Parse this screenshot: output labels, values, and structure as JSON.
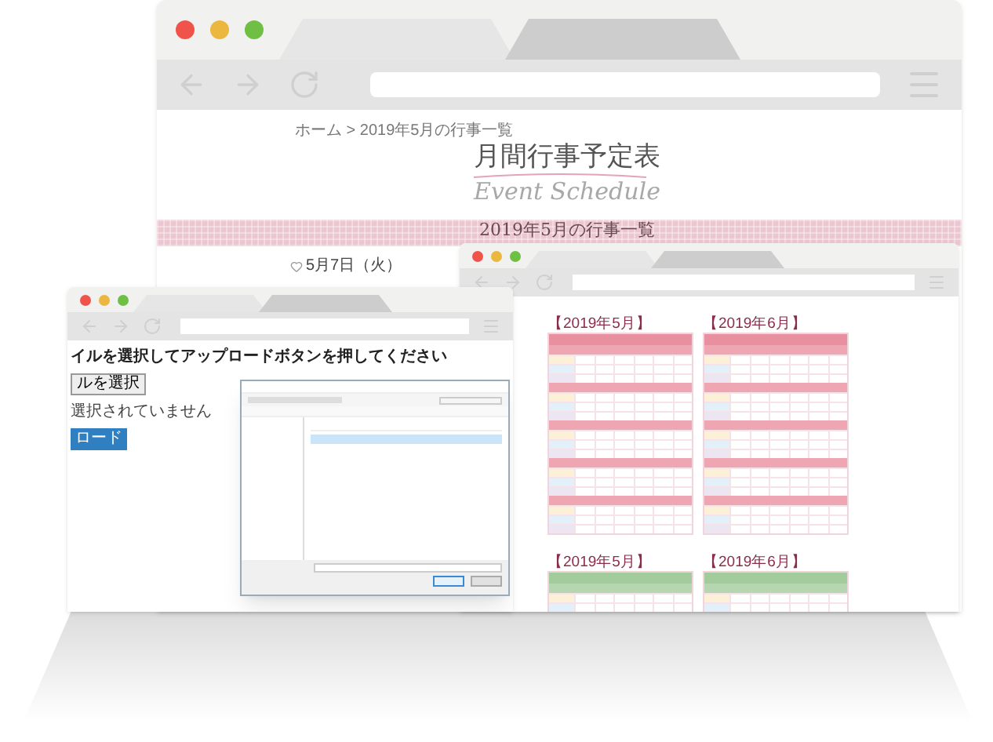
{
  "main_window": {
    "tabs": [
      {
        "selected": true
      },
      {
        "selected": false
      }
    ],
    "breadcrumb": "ホーム > 2019年5月の行事一覧",
    "title": "月間行事予定表",
    "subtitle": "Event Schedule",
    "banner": "2019年5月の行事一覧",
    "date": "5月7日（火）"
  },
  "upload_window": {
    "tabs": [
      {
        "selected": true
      },
      {
        "selected": false
      }
    ],
    "instruction": "イルを選択してアップロードボタンを押してください",
    "choose_button": "ルを選択",
    "file_status": "選択されていません",
    "upload_button": "ロード"
  },
  "schedule_window": {
    "tabs": [
      {
        "selected": true
      },
      {
        "selected": false
      }
    ],
    "sections": [
      {
        "color": "#e8909f",
        "months": [
          "【2019年5月】",
          "【2019年6月】"
        ]
      },
      {
        "color": "#a3cc9c",
        "months": [
          "【2019年5月】",
          "【2019年6月】"
        ]
      }
    ]
  }
}
